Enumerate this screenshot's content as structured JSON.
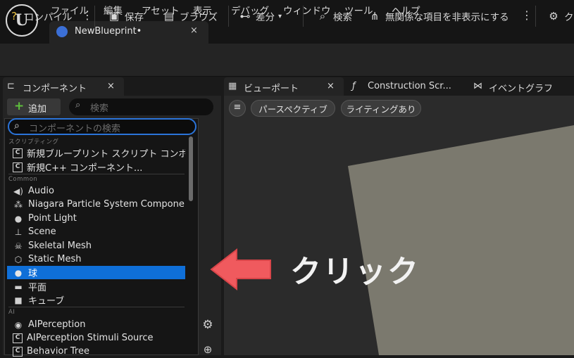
{
  "app": {
    "logo": "U",
    "menu": [
      "ファイル",
      "編集",
      "アセット",
      "表示",
      "デバッグ",
      "ウィンドウ",
      "ツール",
      "ヘルプ"
    ],
    "document_tab": {
      "label": "NewBlueprint•",
      "close": "×"
    }
  },
  "toolbar": {
    "compile": "コンパイル",
    "save": "保存",
    "browse": "ブラウズ",
    "diff": "差分",
    "search": "検索",
    "hide_unrelated": "無関係な項目を非表示にする",
    "more": "ク"
  },
  "panels": {
    "components_tab": "コンポーネント",
    "viewport_tab": "ビューポート",
    "construction_tab": "Construction Scr...",
    "eventgraph_tab": "イベントグラフ",
    "close": "×"
  },
  "components": {
    "add_label": "追加",
    "search_placeholder": "検索"
  },
  "viewport": {
    "perspective": "パースペクティブ",
    "lighting": "ライティングあり"
  },
  "dropdown": {
    "search_placeholder": "コンポーネントの検索",
    "categories": {
      "scripting": "スクリプティング",
      "common": "Common",
      "ai": "AI"
    },
    "scripting_items": [
      "新規ブループリント スクリプト コンポーネント",
      "新規C++ コンポーネント..."
    ],
    "common_items": [
      "Audio",
      "Niagara Particle System Component",
      "Point Light",
      "Scene",
      "Skeletal Mesh",
      "Static Mesh",
      "球",
      "平面",
      "キューブ"
    ],
    "ai_items": [
      "AIPerception",
      "AIPerception Stimuli Source",
      "Behavior Tree"
    ],
    "selected": "球"
  },
  "annotation": {
    "text": "クリック",
    "color": "#f05a5e"
  }
}
